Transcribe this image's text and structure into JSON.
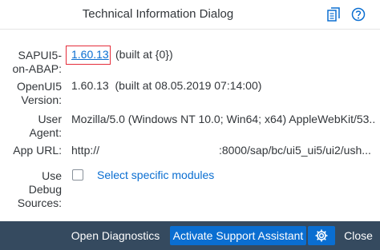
{
  "dialog": {
    "title": "Technical Information Dialog",
    "icons": {
      "copy": "copy-icon",
      "help": "help-icon"
    }
  },
  "fields": {
    "sapui5_label": "SAPUI5-on-ABAP:",
    "sapui5_label_line1": "SAPUI5-",
    "sapui5_label_line2": "on-ABAP:",
    "sapui5_version": "1.60.13",
    "sapui5_built": "(built at {0})",
    "openui5_label_line1": "OpenUI5",
    "openui5_label_line2": "Version:",
    "openui5_value": "1.60.13  (built at 08.05.2019 07:14:00)",
    "useragent_label_line1": "User",
    "useragent_label_line2": "Agent:",
    "useragent_value": "Mozilla/5.0 (Windows NT 10.0; Win64; x64) AppleWebKit/53...",
    "appurl_label": "App URL:",
    "appurl_value_prefix": "http://",
    "appurl_value_suffix": ":8000/sap/bc/ui5_ui5/ui2/ush...",
    "debug_label_line1": "Use",
    "debug_label_line2": "Debug",
    "debug_label_line3": "Sources:",
    "debug_checked": false,
    "select_modules_link": "Select specific modules"
  },
  "footer": {
    "open_diagnostics": "Open Diagnostics",
    "activate_support_assistant": "Activate Support Assistant",
    "settings_icon": "gear-icon",
    "close": "Close"
  },
  "colors": {
    "link": "#0a6ed1",
    "footer_bg": "#354a5f",
    "emphasized_button": "#0a6ed1",
    "highlight_border": "#e52d3a"
  }
}
